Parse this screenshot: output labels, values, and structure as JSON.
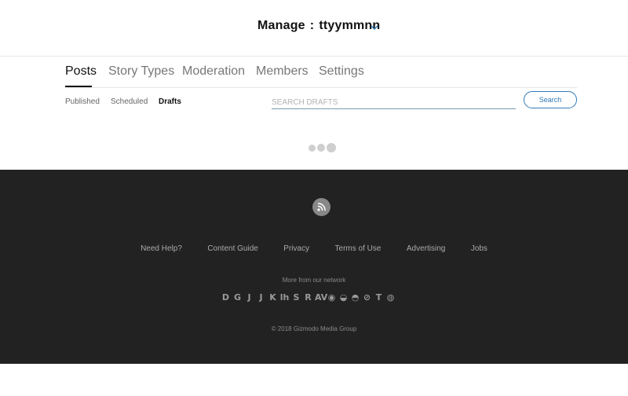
{
  "header": {
    "manage_label": "Manage",
    "separator": ":",
    "blog_name": "ttyymmnn",
    "dropdown_icon": "chevron-down-icon",
    "accent_color": "#2e7ab8"
  },
  "tabs": [
    {
      "label": "Posts",
      "active": true
    },
    {
      "label": "Story Types",
      "active": false
    },
    {
      "label": "Moderation",
      "active": false
    },
    {
      "label": "Members",
      "active": false
    },
    {
      "label": "Settings",
      "active": false
    }
  ],
  "subtabs": [
    {
      "label": "Published",
      "active": false
    },
    {
      "label": "Scheduled",
      "active": false
    },
    {
      "label": "Drafts",
      "active": true
    }
  ],
  "search": {
    "placeholder": "SEARCH DRAFTS",
    "value": "",
    "button_label": "Search"
  },
  "loading_indicator": "three-dots-loading-icon",
  "footer": {
    "background_color": "#222222",
    "rss_icon": "rss-icon",
    "links": [
      "Need Help?",
      "Content Guide",
      "Privacy",
      "Terms of Use",
      "Advertising",
      "Jobs"
    ],
    "network_label": "More from our network",
    "network_icons": [
      {
        "glyph": "D",
        "name": "deadspin-logo-icon"
      },
      {
        "glyph": "G",
        "name": "gizmodo-logo-icon"
      },
      {
        "glyph": "J",
        "name": "jalopnik-logo-icon"
      },
      {
        "glyph": "J",
        "name": "jezebel-logo-icon"
      },
      {
        "glyph": "K",
        "name": "kotaku-logo-icon"
      },
      {
        "glyph": "lh",
        "name": "lifehacker-logo-icon"
      },
      {
        "glyph": "S",
        "name": "splinter-logo-icon"
      },
      {
        "glyph": "R",
        "name": "the-root-logo-icon"
      },
      {
        "glyph": "AV",
        "name": "av-club-logo-icon"
      },
      {
        "glyph": "◉",
        "name": "onion-logo-icon"
      },
      {
        "glyph": "◒",
        "name": "clickhole-logo-icon"
      },
      {
        "glyph": "◓",
        "name": "inventory-logo-icon"
      },
      {
        "glyph": "⊘",
        "name": "earther-logo-icon"
      },
      {
        "glyph": "T",
        "name": "the-takeout-logo-icon"
      },
      {
        "glyph": "◍",
        "name": "the-slot-logo-icon"
      }
    ],
    "copyright": "© 2018 Gizmodo Media Group"
  }
}
